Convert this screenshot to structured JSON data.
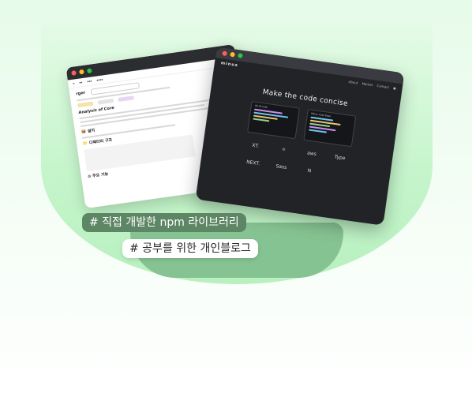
{
  "tags": {
    "primary": "# 직접 개발한 npm 라이브러리",
    "secondary": "# 공부를 위한 개인블로그"
  },
  "blog_window": {
    "brand": "rger",
    "heading": "Analysis of Core",
    "section_install": "설치",
    "section_structure": "디렉터리 구조",
    "section_features": "주요 기능"
  },
  "library_window": {
    "logo": "minus",
    "nav": [
      "About",
      "Market",
      "Contact"
    ],
    "headline": "Make the code concise",
    "panel_left_title": "AS-IS code",
    "panel_right_title": "Minus code base",
    "tech_logos": [
      "XT.",
      "React",
      "aws",
      "Type",
      "NEXT.",
      "Sass",
      "Notion"
    ]
  },
  "colors": {
    "accent_green": "#86c392",
    "tag_dark": "#5d8664",
    "window_dark": "#222327"
  }
}
